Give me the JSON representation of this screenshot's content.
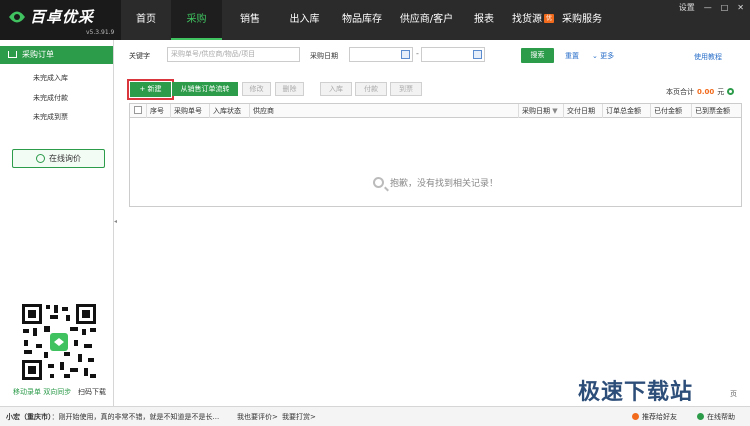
{
  "app": {
    "name": "百卓优采",
    "version": "v5.3.91.9"
  },
  "nav": {
    "items": [
      {
        "label": "首页"
      },
      {
        "label": "采购"
      },
      {
        "label": "销售"
      },
      {
        "label": "出入库"
      },
      {
        "label": "物品库存"
      },
      {
        "label": "供应商/客户"
      },
      {
        "label": "报表"
      },
      {
        "label": "找货源",
        "badge": "优"
      },
      {
        "label": "采购服务"
      }
    ],
    "active": "采购"
  },
  "window": {
    "settings_label": "设置",
    "minimize": "—",
    "maximize": "□",
    "close": "✕"
  },
  "sidebar": {
    "header": "采购订单",
    "items": [
      {
        "label": "未完成入库"
      },
      {
        "label": "未完成付款"
      },
      {
        "label": "未完成到票"
      }
    ],
    "inquiry_button": "在线询价",
    "qr_caption": "移动录单 双向同步",
    "qr_download": "扫码下载"
  },
  "filters": {
    "keyword_label": "关键字",
    "keyword_placeholder": "采购单号/供应商/物品/项目",
    "date_label": "采购日期",
    "date_separator": "-",
    "search_button": "搜索",
    "reset_link": "重置",
    "more_link": "更多",
    "tutorial_link": "使用教程"
  },
  "toolbar": {
    "new_button": "+ 新建",
    "from_sales_button": "从销售订单流转",
    "edit_button": "修改",
    "delete_button": "删除",
    "stock_in_button": "入库",
    "pay_button": "付款",
    "invoice_button": "到票",
    "page_total_label": "本页合计",
    "page_total_value": "0.00",
    "page_total_unit": "元"
  },
  "table": {
    "columns": [
      "序号",
      "采购单号",
      "入库状态",
      "供应商",
      "采购日期",
      "交付日期",
      "订单总金额",
      "已付金额",
      "已到票金额"
    ],
    "sort_indicator": "▼",
    "empty_message": "抱歉，没有找到相关记录！"
  },
  "statusbar": {
    "user": "小宏（重庆市）",
    "message": "：刚开始使用，真的非常不错，就是不知道是不是长...",
    "review_link": "我也要评价>",
    "reward_link": "我要打赏>",
    "recommend_link": "推荐给好友",
    "help_link": "在线帮助"
  },
  "watermark": "极速下载站",
  "pager_fragment": "页"
}
